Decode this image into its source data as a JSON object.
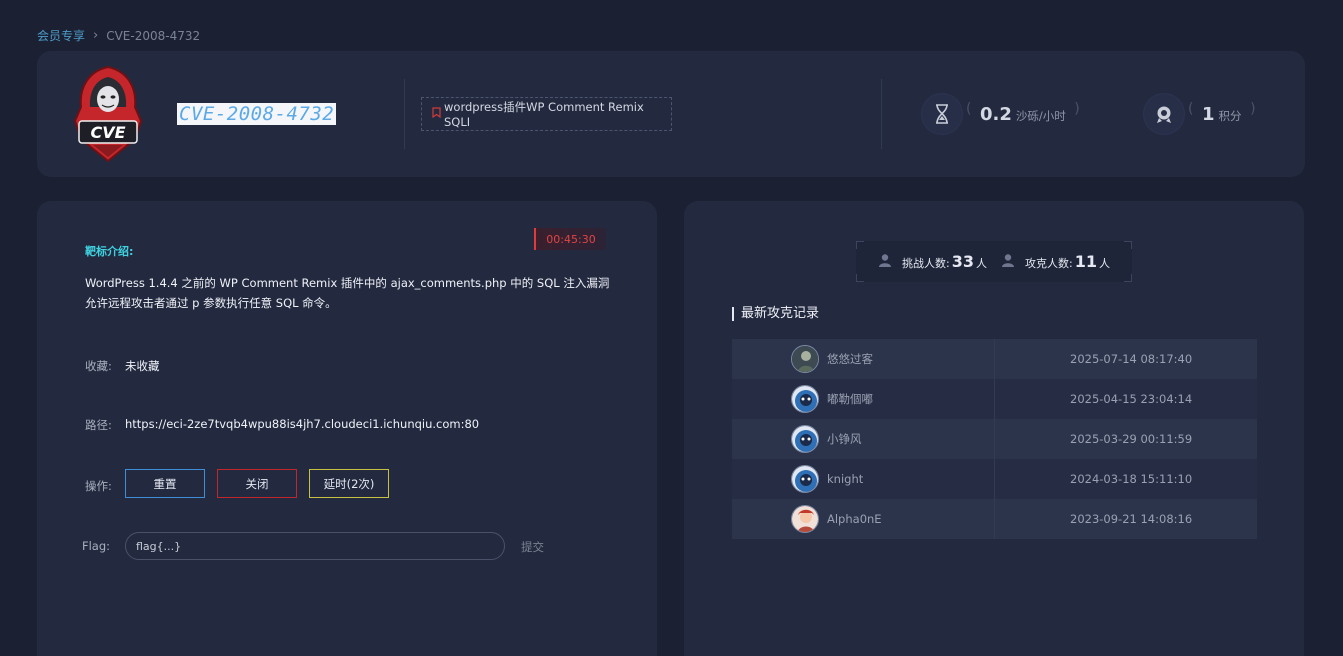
{
  "breadcrumb": {
    "parent": "会员专享",
    "separator": "›",
    "current": "CVE-2008-4732"
  },
  "header": {
    "logo_text": "CVE",
    "title": "CVE-2008-4732",
    "tag": "wordpress插件WP Comment Remix SQLI",
    "rate": {
      "value": "0.2",
      "unit": "沙砾/小时"
    },
    "points": {
      "value": "1",
      "unit": "积分"
    }
  },
  "target": {
    "intro_label": "靶标介绍:",
    "timer": "00:45:30",
    "description": "WordPress 1.4.4 之前的 WP Comment Remix 插件中的 ajax_comments.php 中的 SQL 注入漏洞允许远程攻击者通过 p 参数执行任意 SQL 命令。",
    "favorite_label": "收藏:",
    "favorite_value": "未收藏",
    "path_label": "路径:",
    "path_value": "https://eci-2ze7tvqb4wpu88is4jh7.cloudeci1.ichunqiu.com:80",
    "ops_label": "操作:",
    "reset_button": "重置",
    "close_button": "关闭",
    "delay_button": "延时(2次)",
    "flag_label": "Flag:",
    "flag_placeholder": "flag{...}",
    "submit_label": "提交"
  },
  "stats": {
    "challengers_label": "挑战人数:",
    "challengers_value": "33",
    "challengers_unit": "人",
    "solvers_label": "攻克人数:",
    "solvers_value": "11",
    "solvers_unit": "人"
  },
  "records": {
    "title": "最新攻克记录",
    "rows": [
      {
        "name": "悠悠过客",
        "time": "2025-07-14 08:17:40",
        "avatar_color": "#5a6b5e"
      },
      {
        "name": "嘟勒個嘟",
        "time": "2025-04-15 23:04:14",
        "avatar_color": "#2f6fb5"
      },
      {
        "name": "小铮风",
        "time": "2025-03-29 00:11:59",
        "avatar_color": "#2f6fb5"
      },
      {
        "name": "knight",
        "time": "2024-03-18 15:11:10",
        "avatar_color": "#2f6fb5"
      },
      {
        "name": "Alpha0nE",
        "time": "2023-09-21 14:08:16",
        "avatar_color": "#b54a3a"
      }
    ]
  },
  "colors": {
    "background": "#1b2133",
    "card": "#232a40",
    "accent_cyan": "#3fd2e0",
    "timer_red": "#e04444",
    "reset_blue": "#3d8ed6",
    "close_red": "#c0272d",
    "delay_yellow": "#c8c040"
  },
  "icons": {
    "rate": "hourglass-icon",
    "points": "medal-icon",
    "tag": "bookmark-icon",
    "person": "person-icon"
  }
}
